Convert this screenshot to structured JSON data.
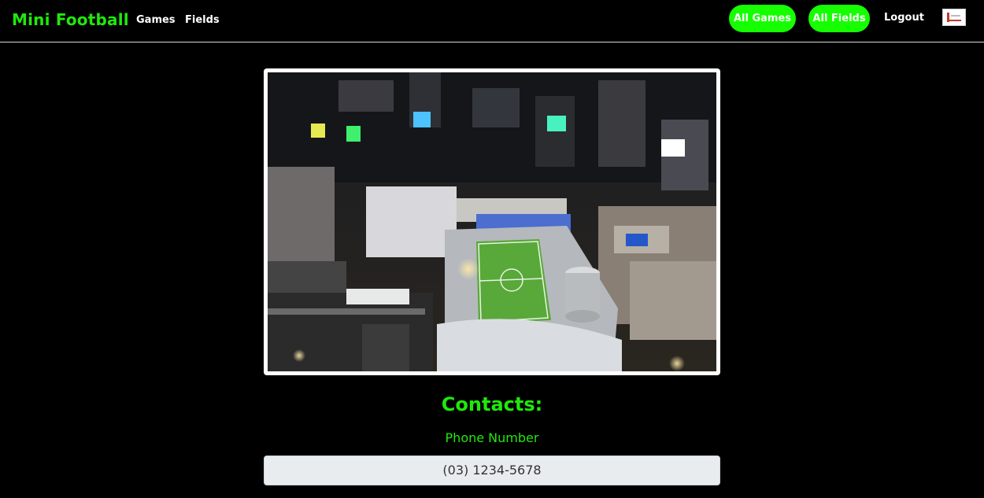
{
  "navbar": {
    "brand": "Mini Football",
    "links": [
      "Games",
      "Fields"
    ],
    "buttons": [
      "All Games",
      "All Fields"
    ],
    "logout": "Logout"
  },
  "contacts": {
    "title": "Contacts:",
    "phone_label": "Phone Number",
    "phone_value": "(03) 1234-5678"
  },
  "colors": {
    "accent": "#1fe90b",
    "button_bg": "#15ff00",
    "background": "#000000"
  }
}
